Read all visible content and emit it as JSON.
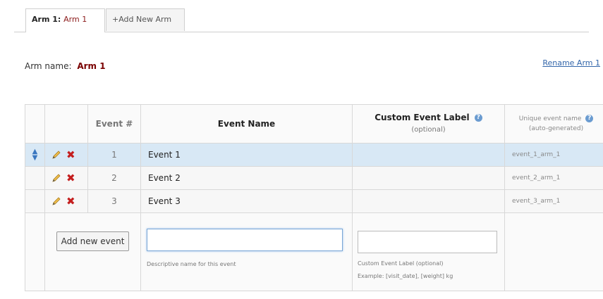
{
  "tabs": [
    {
      "prefix": "Arm 1:",
      "name": "Arm 1"
    },
    {
      "label": "+Add New Arm"
    }
  ],
  "arm": {
    "label": "Arm name:",
    "value": "Arm 1",
    "rename": "Rename Arm 1"
  },
  "table": {
    "headers": {
      "event_num": "Event #",
      "event_name": "Event Name",
      "custom_label": "Custom Event Label",
      "custom_label_sub": "(optional)",
      "unique": "Unique event name",
      "unique_sub": "(auto-generated)"
    },
    "rows": [
      {
        "num": "1",
        "name": "Event 1",
        "label": "",
        "unique": "event_1_arm_1"
      },
      {
        "num": "2",
        "name": "Event 2",
        "label": "",
        "unique": "event_2_arm_1"
      },
      {
        "num": "3",
        "name": "Event 3",
        "label": "",
        "unique": "event_3_arm_1"
      }
    ],
    "add_button": "Add new event",
    "name_input_value": "",
    "name_hint": "Descriptive name for this event",
    "label_hint": "Custom Event Label (optional)",
    "label_example": "Example: [visit_date], [weight] kg"
  },
  "icons": {
    "help": "help-icon",
    "pencil": "pencil-icon",
    "delete": "delete-icon",
    "move": "move-icon"
  },
  "colors": {
    "selected_row": "#d8e8f5",
    "arm_name": "#7a0000",
    "delete": "#c41e1e",
    "link": "#3366aa"
  }
}
